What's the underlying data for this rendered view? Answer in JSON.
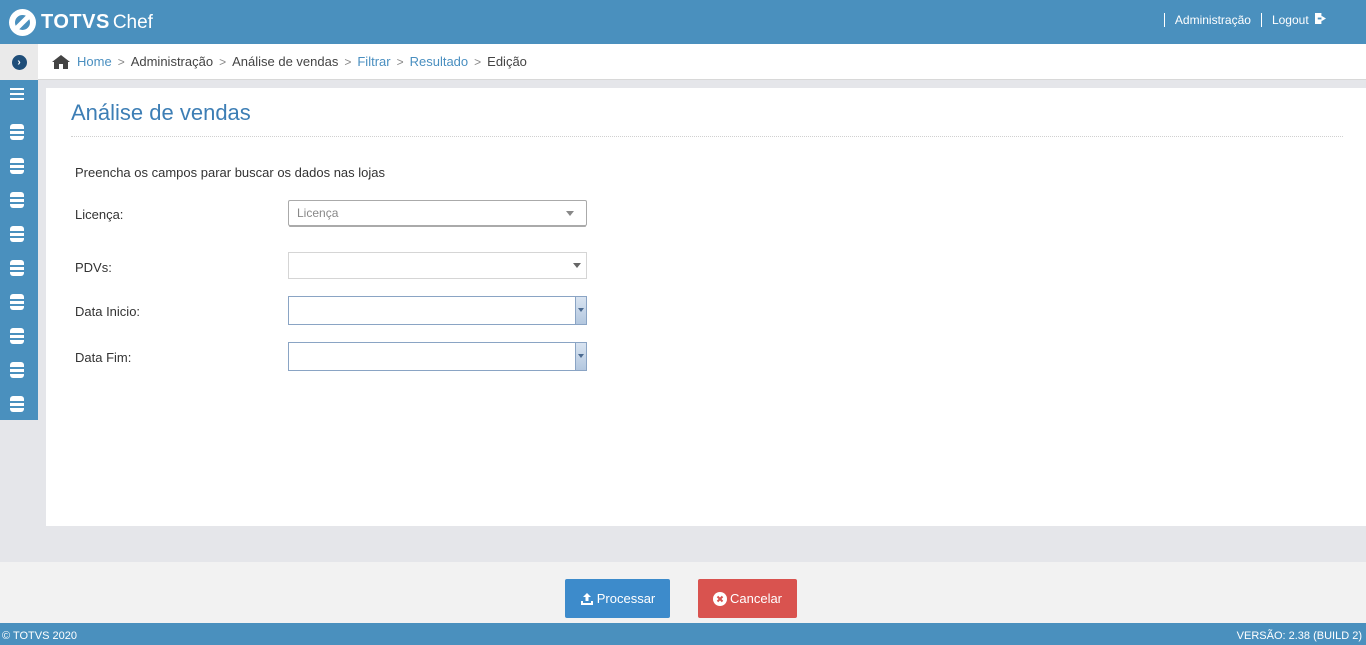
{
  "header": {
    "logo_primary": "TOTVS",
    "logo_secondary": "Chef",
    "admin_link": "Administração",
    "logout_link": "Logout"
  },
  "breadcrumb": {
    "items": [
      {
        "label": "Home",
        "link": true
      },
      {
        "label": "Administração",
        "link": false
      },
      {
        "label": "Análise de vendas",
        "link": false
      },
      {
        "label": "Filtrar",
        "link": true
      },
      {
        "label": "Resultado",
        "link": true
      },
      {
        "label": "Edição",
        "link": false
      }
    ]
  },
  "sidebar": {
    "icons": [
      "menu-icon",
      "database-icon",
      "database-icon",
      "database-icon",
      "database-icon",
      "database-icon",
      "database-icon",
      "database-icon",
      "database-icon",
      "database-icon"
    ]
  },
  "page": {
    "title": "Análise de vendas",
    "instructions": "Preencha os campos parar buscar os dados nas lojas",
    "fields": {
      "licenca": {
        "label": "Licença:",
        "placeholder": "Licença",
        "value": ""
      },
      "pdvs": {
        "label": "PDVs:",
        "value": ""
      },
      "data_inicio": {
        "label": "Data Inicio:",
        "value": ""
      },
      "data_fim": {
        "label": "Data Fim:",
        "value": ""
      }
    }
  },
  "actions": {
    "process_label": "Processar",
    "cancel_label": "Cancelar"
  },
  "footer": {
    "copyright": "© TOTVS 2020",
    "version": "VERSÃO: 2.38 (BUILD 2)"
  },
  "colors": {
    "brand_blue": "#4a90be",
    "process_button": "#3d8bcb",
    "cancel_button": "#d9534f",
    "title_blue": "#3d7eb5"
  }
}
